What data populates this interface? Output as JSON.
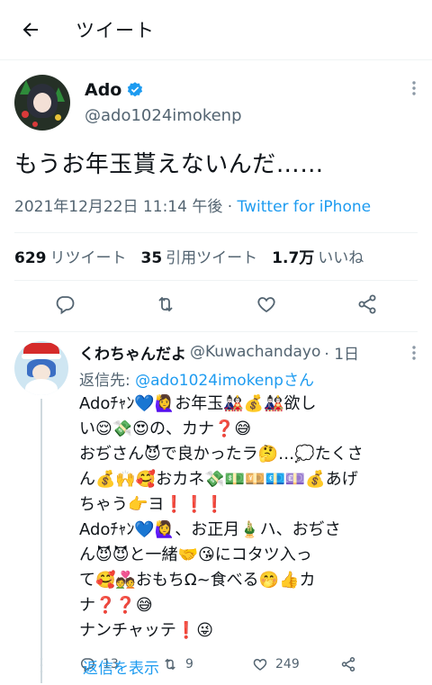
{
  "header": {
    "title": "ツイート",
    "back_icon": "arrow-left-icon"
  },
  "tweet": {
    "author_name": "Ado",
    "author_handle": "@ado1024imokenp",
    "verified": true,
    "text": "もうお年玉貰えないんだ……",
    "timestamp": "2021年12月22日 11:14 午後",
    "separator": " · ",
    "source": "Twitter for iPhone",
    "stats": {
      "retweets_count": "629",
      "retweets_label": "リツイート",
      "quotes_count": "35",
      "quotes_label": "引用ツイート",
      "likes_count": "1.7万",
      "likes_label": "いいね"
    }
  },
  "reply": {
    "name": "くわちゃんだよ",
    "handle": "@Kuwachandayo",
    "time": "· 1日",
    "replying_prefix": "返信先: ",
    "replying_to": "@ado1024imokenpさん",
    "text": "Adoﾁｬﾝ💙🙋‍♀️お年玉🎎💰🎎欲し\nい😌💸😍の、カナ❓😅\nおぢさん😈で良かったラ🤔…💭たくさ\nん💰🙌🥰おカネ💸💵💴💶💷💰あげ\nちゃう👉ヨ❗❗❗\nAdoﾁｬﾝ💙🙋‍♀️、お正月🎍ハ、おぢさ\nん😈😈と一緒🤝😘にコタツ入っ\nて🥰💑おもちΩ~食べる🤭👍カ\nナ❓❓😅\nナンチャッテ❗😜",
    "replies_count": "13",
    "retweets_count": "9",
    "likes_count": "249"
  },
  "show_replies": "返信を表示",
  "colors": {
    "accent": "#1d9bf0",
    "secondary_text": "#536471",
    "border": "#eff3f4"
  }
}
